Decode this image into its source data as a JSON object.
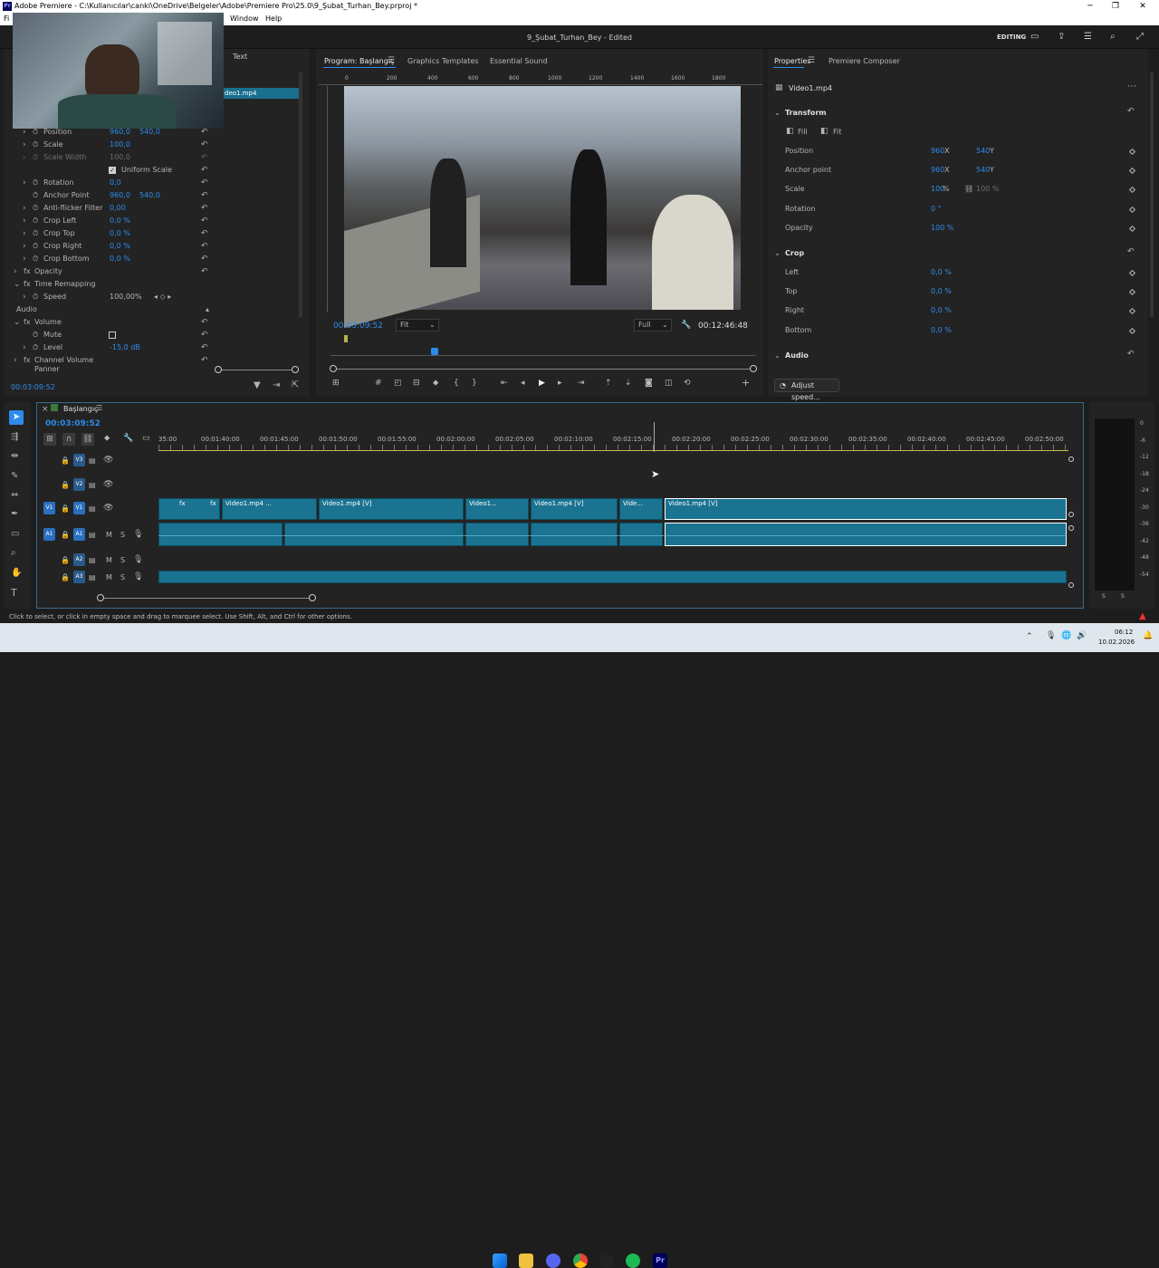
{
  "window": {
    "title": "Adobe Premiere - C:\\Kullanıcılar\\canki\\OneDrive\\Belgeler\\Adobe\\Premiere Pro\\25.0\\9_Şubat_Turhan_Bey.prproj *",
    "logo": "Pr"
  },
  "menu": {
    "file": "Fi",
    "window": "Window",
    "help": "Help"
  },
  "header": {
    "project": "9_Şubat_Turhan_Bey - Edited",
    "workspace": "EDITING"
  },
  "effects": {
    "text_tab": "Text",
    "clip": "deo1.mp4",
    "rows": [
      {
        "label": "Position",
        "v1": "960,0",
        "v2": "540,0"
      },
      {
        "label": "Scale",
        "v1": "100,0",
        "v2": ""
      },
      {
        "label": "Scale Width",
        "v1": "100,0",
        "v2": ""
      },
      {
        "label": "Uniform Scale",
        "v1": "",
        "v2": ""
      },
      {
        "label": "Rotation",
        "v1": "0,0",
        "v2": ""
      },
      {
        "label": "Anchor Point",
        "v1": "960,0",
        "v2": "540,0"
      },
      {
        "label": "Anti-flicker Filter",
        "v1": "0,00",
        "v2": ""
      },
      {
        "label": "Crop Left",
        "v1": "0,0 %",
        "v2": ""
      },
      {
        "label": "Crop Top",
        "v1": "0,0 %",
        "v2": ""
      },
      {
        "label": "Crop Right",
        "v1": "0,0 %",
        "v2": ""
      },
      {
        "label": "Crop Bottom",
        "v1": "0,0 %",
        "v2": ""
      },
      {
        "label": "Opacity",
        "v1": "",
        "v2": ""
      },
      {
        "label": "Time Remapping",
        "v1": "",
        "v2": ""
      },
      {
        "label": "Speed",
        "v1": "100,00%",
        "v2": ""
      },
      {
        "label": "Audio",
        "v1": "",
        "v2": ""
      },
      {
        "label": "Volume",
        "v1": "",
        "v2": ""
      },
      {
        "label": "Mute",
        "v1": "",
        "v2": ""
      },
      {
        "label": "Level",
        "v1": "-15,0 dB",
        "v2": ""
      },
      {
        "label": "Channel Volume",
        "v1": "",
        "v2": ""
      },
      {
        "label": "Panner",
        "v1": "",
        "v2": ""
      }
    ],
    "timecode": "00:03:09:52"
  },
  "program": {
    "tabs": [
      "Program: Başlangıç",
      "Graphics Templates",
      "Essential Sound"
    ],
    "ruler": [
      "0",
      "200",
      "400",
      "600",
      "800",
      "1000",
      "1200",
      "1400",
      "1600",
      "1800"
    ],
    "timecode": "00:03:09:52",
    "zoom": "Fit",
    "quality": "Full",
    "duration": "00:12:46:48"
  },
  "properties": {
    "tabs": [
      "Properties",
      "Premiere Composer"
    ],
    "clip": "Video1.mp4",
    "transform": "Transform",
    "fill": "Fill",
    "fit": "Fit",
    "position_label": "Position",
    "position_x": "960",
    "position_y": "540",
    "anchor_label": "Anchor point",
    "anchor_x": "960",
    "anchor_y": "540",
    "scale_label": "Scale",
    "scale": "100",
    "scale2": "100 %",
    "rotation_label": "Rotation",
    "rotation": "0 °",
    "opacity_label": "Opacity",
    "opacity": "100 %",
    "crop": "Crop",
    "left_label": "Left",
    "left": "0,0 %",
    "top_label": "Top",
    "top": "0,0 %",
    "right_label": "Right",
    "right": "0,0 %",
    "bottom_label": "Bottom",
    "bottom": "0,0 %",
    "audio": "Audio",
    "adjust": "Adjust speed...",
    "unit_x": "X",
    "unit_y": "Y",
    "unit_pct": "%"
  },
  "timeline": {
    "sequence": "Başlangıç",
    "timecode": "00:03:09:52",
    "ticks": [
      "35:00",
      "00:01:40:00",
      "00:01:45:00",
      "00:01:50:00",
      "00:01:55:00",
      "00:02:00:00",
      "00:02:05:00",
      "00:02:10:00",
      "00:02:15:00",
      "00:02:20:00",
      "00:02:25:00",
      "00:02:30:00",
      "00:02:35:00",
      "00:02:40:00",
      "00:02:45:00",
      "00:02:50:00"
    ],
    "tracks": {
      "v3": "V3",
      "v2": "V2",
      "v1": "V1",
      "a1": "A1",
      "a2": "A2",
      "a3": "A3",
      "m": "M",
      "s": "S"
    },
    "clips": [
      "Video1.mp4 ...",
      "Video1.mp4 [V]",
      "Video1...",
      "Video1.mp4 [V]",
      "Vide...",
      "Video1.mp4 [V]"
    ],
    "fx": "fx"
  },
  "meter": {
    "labels": [
      "0",
      "-6",
      "-12",
      "-18",
      "-24",
      "-30",
      "-36",
      "-42",
      "-48",
      "-54"
    ],
    "s": "S"
  },
  "status": "Click to select, or click in empty space and drag to marquee select. Use Shift, Alt, and Ctrl for other options.",
  "taskbar": {
    "time": "06:12",
    "date": "10.02.2026"
  }
}
